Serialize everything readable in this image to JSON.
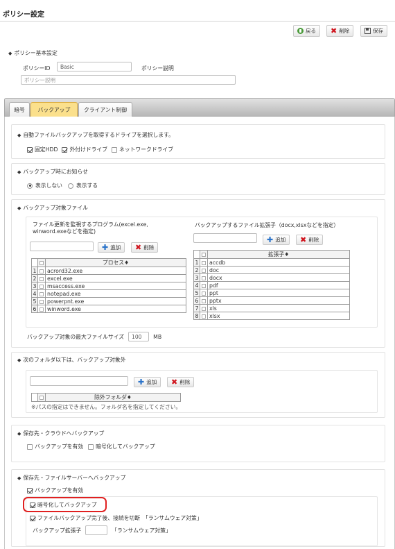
{
  "page": {
    "title": "ポリシー設定"
  },
  "toolbar": {
    "back_label": "戻る",
    "delete_label": "削除",
    "save_label": "保存"
  },
  "basic": {
    "heading": "ポリシー基本設定",
    "id_label": "ポリシーID",
    "id_value": "Basic",
    "desc_label": "ポリシー説明",
    "desc_placeholder": "ポリシー説明"
  },
  "tabs": [
    {
      "label": "暗号",
      "active": false
    },
    {
      "label": "バックアップ",
      "active": true
    },
    {
      "label": "クライアント制御",
      "active": false
    }
  ],
  "drive": {
    "heading": "自動ファイルバックアップを取得するドライブを選択します。",
    "options": [
      {
        "label": "固定HDD",
        "checked": true
      },
      {
        "label": "外付けドライブ",
        "checked": true
      },
      {
        "label": "ネットワークドライブ",
        "checked": false
      }
    ]
  },
  "notify": {
    "heading": "バックアップ時にお知らせ",
    "options": [
      {
        "label": "表示しない",
        "selected": true
      },
      {
        "label": "表示する",
        "selected": false
      }
    ]
  },
  "target": {
    "heading": "バックアップ対象ファイル",
    "programs": {
      "desc": [
        "ファイル更新を監視するプログラム(excel.exe,",
        "winword.exeなどを指定)"
      ],
      "add_label": "追加",
      "delete_label": "削除",
      "column": "プロセス",
      "sort_mark": "♦",
      "rows": [
        "acrord32.exe",
        "excel.exe",
        "msaccess.exe",
        "notepad.exe",
        "powerpnt.exe",
        "winword.exe"
      ]
    },
    "extensions": {
      "desc": "バックアップするファイル拡張子（docx,xlsxなどを指定）",
      "add_label": "追加",
      "delete_label": "削除",
      "column": "拡張子",
      "sort_mark": "♦",
      "rows": [
        "accdb",
        "doc",
        "docx",
        "pdf",
        "ppt",
        "pptx",
        "xls",
        "xlsx"
      ]
    },
    "maxsize_label": "バックアップ対象の最大ファイルサイズ",
    "maxsize_value": "100",
    "maxsize_unit": "MB"
  },
  "exclude": {
    "heading": "次のフォルダ以下は、バックアップ対象外",
    "add_label": "追加",
    "delete_label": "削除",
    "column": "除外フォルダ",
    "sort_mark": "♦",
    "note": "※パスの指定はできません。フォルダ名を指定してください。"
  },
  "cloud": {
    "heading": "保存先・クラウドへバックアップ",
    "options": [
      {
        "label": "バックアップを有効",
        "checked": false
      },
      {
        "label": "暗号化してバックアップ",
        "checked": false
      }
    ]
  },
  "fileserver": {
    "heading": "保存先・ファイルサーバーへバックアップ",
    "enable_label": "バックアップを有効",
    "enable_checked": true,
    "encrypt_label": "暗号化してバックアップ",
    "encrypt_checked": true,
    "disconnect_label": "ファイルバックアップ完了後、接続を切断　「ランサムウェア対策」",
    "disconnect_checked": true,
    "ext_label": "バックアップ拡張子",
    "ext_value": "",
    "ext_note": "「ランサムウェア対策」"
  }
}
